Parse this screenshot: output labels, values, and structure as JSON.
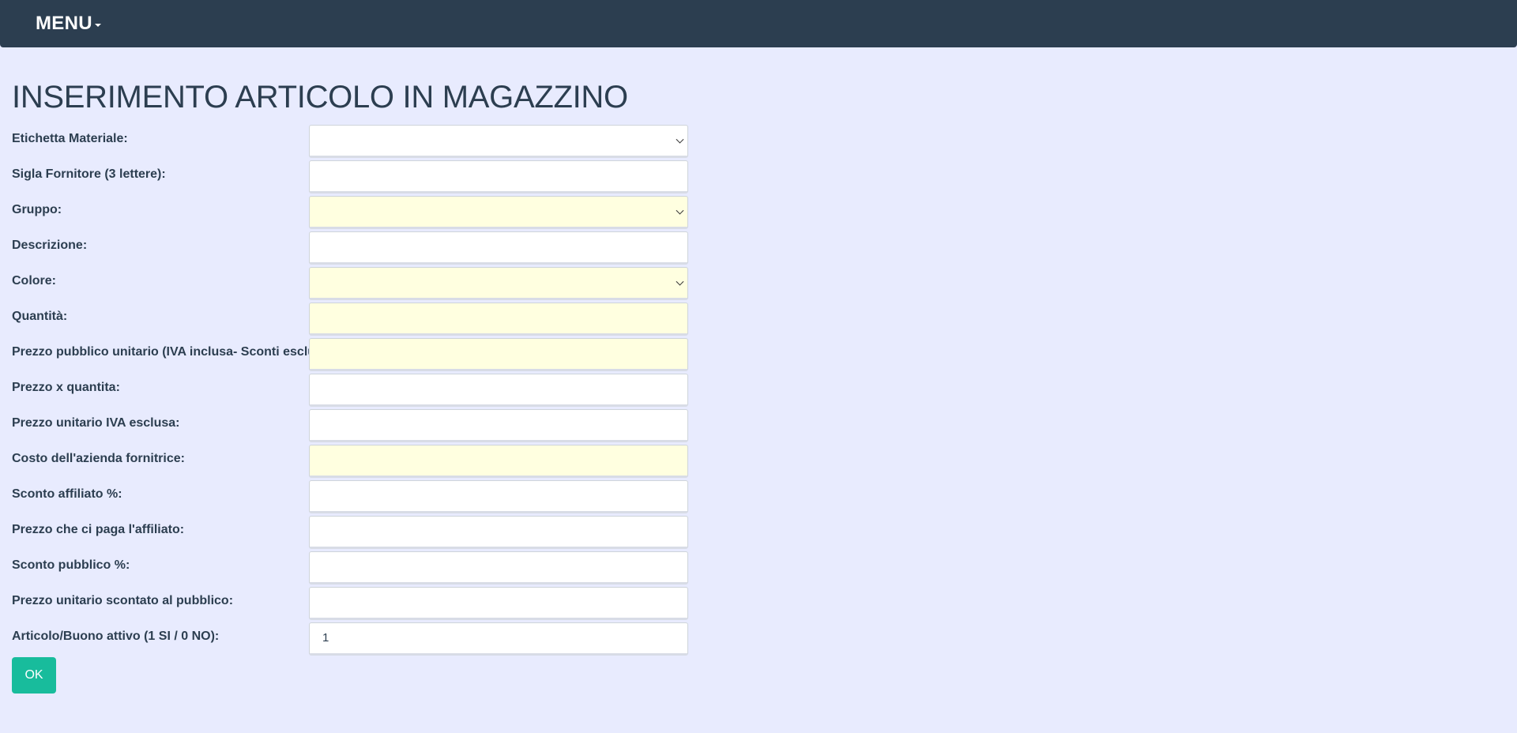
{
  "navbar": {
    "menu_label": "MENU"
  },
  "page": {
    "title": "INSERIMENTO ARTICOLO IN MAGAZZINO"
  },
  "form": {
    "fields": [
      {
        "label": "Etichetta Materiale:",
        "type": "select",
        "value": "",
        "required": false
      },
      {
        "label": "Sigla Fornitore (3 lettere):",
        "type": "text",
        "value": "",
        "required": false
      },
      {
        "label": "Gruppo:",
        "type": "select",
        "value": "",
        "required": true
      },
      {
        "label": "Descrizione:",
        "type": "text",
        "value": "",
        "required": false
      },
      {
        "label": "Colore:",
        "type": "select",
        "value": "",
        "required": true
      },
      {
        "label": "Quantità:",
        "type": "text",
        "value": "",
        "required": true
      },
      {
        "label": "Prezzo pubblico unitario (IVA inclusa- Sconti esclusi):",
        "type": "text",
        "value": "",
        "required": true
      },
      {
        "label": "Prezzo x quantita:",
        "type": "text",
        "value": "",
        "required": false
      },
      {
        "label": "Prezzo unitario IVA esclusa:",
        "type": "text",
        "value": "",
        "required": false
      },
      {
        "label": "Costo dell'azienda fornitrice:",
        "type": "text",
        "value": "",
        "required": true
      },
      {
        "label": "Sconto affiliato %:",
        "type": "text",
        "value": "",
        "required": false
      },
      {
        "label": "Prezzo che ci paga l'affiliato:",
        "type": "text",
        "value": "",
        "required": false
      },
      {
        "label": "Sconto pubblico %:",
        "type": "text",
        "value": "",
        "required": false
      },
      {
        "label": "Prezzo unitario scontato al pubblico:",
        "type": "text",
        "value": "",
        "required": false
      },
      {
        "label": "Articolo/Buono attivo (1 SI / 0 NO):",
        "type": "text",
        "value": "1",
        "required": false
      }
    ],
    "submit_label": "OK"
  },
  "colors": {
    "navbar_bg": "#2c3e50",
    "page_bg": "#e8ebfe",
    "required_field_bg": "#ffffe0",
    "button_bg": "#18bc9c"
  }
}
